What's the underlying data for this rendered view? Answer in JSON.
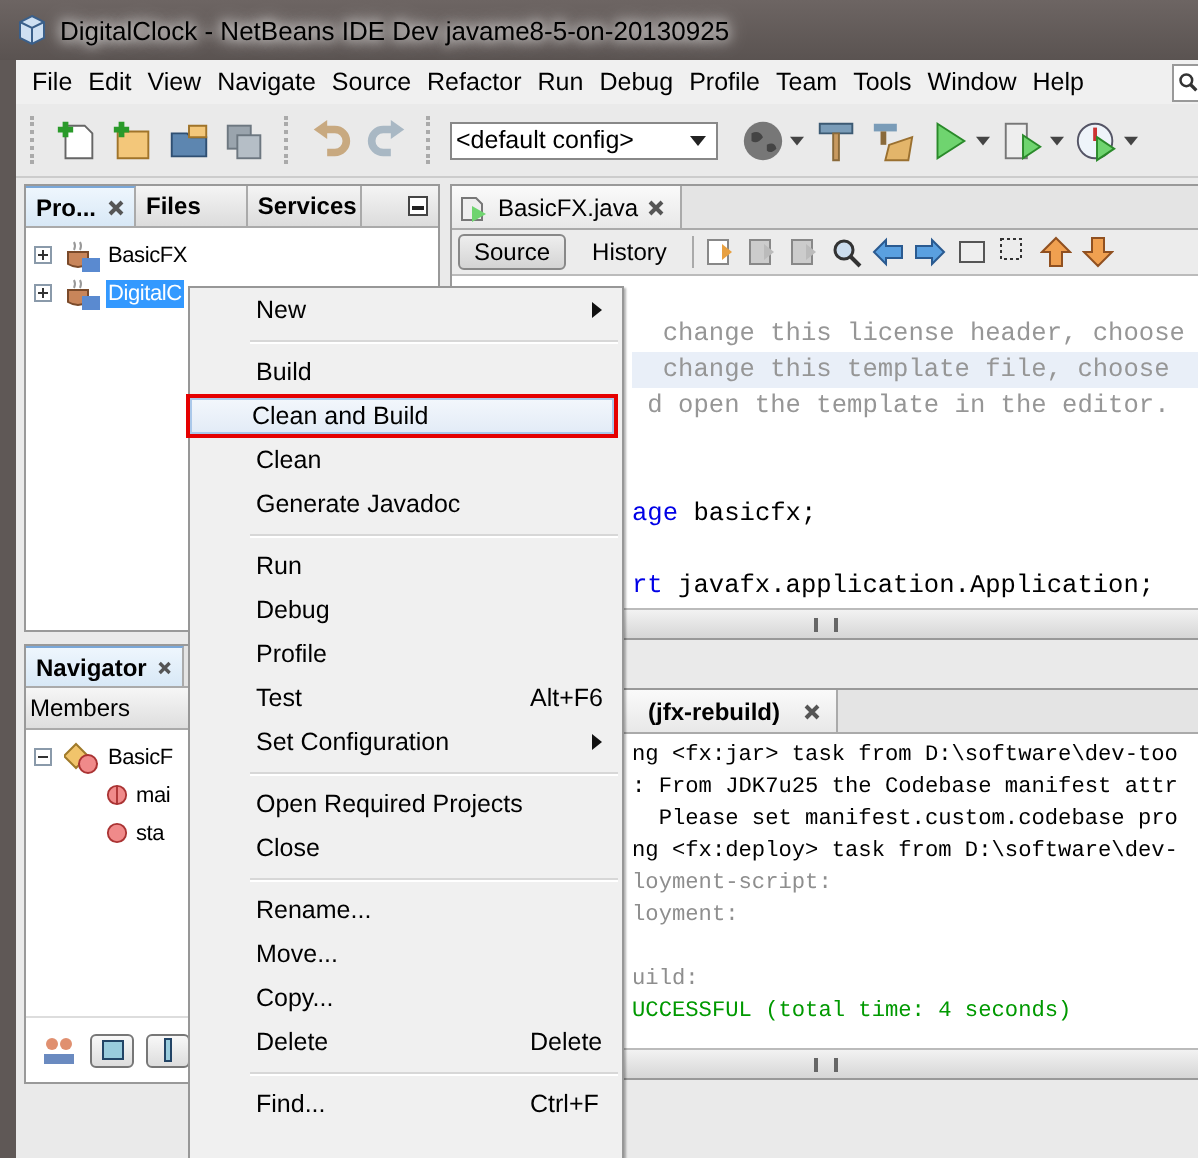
{
  "window": {
    "title": "DigitalClock - NetBeans IDE Dev javame8-5-on-20130925"
  },
  "menubar": [
    "File",
    "Edit",
    "View",
    "Navigate",
    "Source",
    "Refactor",
    "Run",
    "Debug",
    "Profile",
    "Team",
    "Tools",
    "Window",
    "Help"
  ],
  "toolbar": {
    "config": "<default config>"
  },
  "projects_panel": {
    "tabs": [
      {
        "label": "Pro...",
        "selected": true,
        "closable": true
      },
      {
        "label": "Files",
        "selected": false,
        "closable": false
      },
      {
        "label": "Services",
        "selected": false,
        "closable": false
      }
    ],
    "tree": [
      {
        "label": "BasicFX",
        "selected": false
      },
      {
        "label": "DigitalC",
        "selected": true
      }
    ]
  },
  "navigator": {
    "tab": "Navigator",
    "filter": "Members",
    "tree": {
      "label": "BasicF",
      "expanded": true,
      "children": [
        {
          "label": "mai",
          "kind": "method"
        },
        {
          "label": "sta",
          "kind": "field"
        }
      ]
    }
  },
  "editor": {
    "tab": "BasicFX.java",
    "views": [
      {
        "label": "Source",
        "selected": true
      },
      {
        "label": "History",
        "selected": false
      }
    ],
    "lines": [
      {
        "kind": "code",
        "current": false,
        "parts": [
          {
            "text": "  change this license header, choose",
            "kind": "comment"
          }
        ]
      },
      {
        "kind": "code",
        "current": true,
        "parts": [
          {
            "text": "  change this template file, choose",
            "kind": "comment"
          }
        ]
      },
      {
        "kind": "code",
        "current": false,
        "parts": [
          {
            "text": " d open the template in the editor.",
            "kind": "comment"
          }
        ]
      },
      {
        "kind": "blank"
      },
      {
        "kind": "blank"
      },
      {
        "kind": "code",
        "current": false,
        "parts": [
          {
            "text": "age",
            "kind": "keyword"
          },
          {
            "text": " basicfx;",
            "kind": "plain"
          }
        ]
      },
      {
        "kind": "blank"
      },
      {
        "kind": "code",
        "current": false,
        "parts": [
          {
            "text": "rt",
            "kind": "keyword"
          },
          {
            "text": " javafx.application.Application;",
            "kind": "plain"
          }
        ]
      }
    ]
  },
  "output": {
    "tab": "(jfx-rebuild)",
    "lines": [
      {
        "text": "ng <fx:jar> task from D:\\software\\dev-too",
        "kind": "plain"
      },
      {
        "text": ": From JDK7u25 the Codebase manifest attr",
        "kind": "plain"
      },
      {
        "text": "  Please set manifest.custom.codebase pro",
        "kind": "plain"
      },
      {
        "text": "ng <fx:deploy> task from D:\\software\\dev-",
        "kind": "plain"
      },
      {
        "text": "loyment-script:",
        "kind": "muted"
      },
      {
        "text": "loyment:",
        "kind": "muted"
      },
      {
        "kind": "blank"
      },
      {
        "text": "uild:",
        "kind": "muted"
      },
      {
        "text": "UCCESSFUL (total time: 4 seconds)",
        "kind": "success"
      }
    ]
  },
  "context_menu": [
    {
      "kind": "item",
      "label": "New",
      "submenu": true,
      "selected": false,
      "annotated": false
    },
    {
      "kind": "separator"
    },
    {
      "kind": "item",
      "label": "Build",
      "submenu": false,
      "selected": false,
      "annotated": false
    },
    {
      "kind": "item",
      "label": "Clean and Build",
      "submenu": false,
      "selected": true,
      "annotated": true
    },
    {
      "kind": "item",
      "label": "Clean",
      "submenu": false,
      "selected": false,
      "annotated": false
    },
    {
      "kind": "item",
      "label": "Generate Javadoc",
      "submenu": false,
      "selected": false,
      "annotated": false
    },
    {
      "kind": "separator"
    },
    {
      "kind": "item",
      "label": "Run",
      "submenu": false,
      "selected": false,
      "annotated": false
    },
    {
      "kind": "item",
      "label": "Debug",
      "submenu": false,
      "selected": false,
      "annotated": false
    },
    {
      "kind": "item",
      "label": "Profile",
      "submenu": false,
      "selected": false,
      "annotated": false
    },
    {
      "kind": "item",
      "label": "Test",
      "shortcut": "Alt+F6",
      "submenu": false,
      "selected": false,
      "annotated": false
    },
    {
      "kind": "item",
      "label": "Set Configuration",
      "submenu": true,
      "selected": false,
      "annotated": false
    },
    {
      "kind": "separator"
    },
    {
      "kind": "item",
      "label": "Open Required Projects",
      "submenu": false,
      "selected": false,
      "annotated": false
    },
    {
      "kind": "item",
      "label": "Close",
      "submenu": false,
      "selected": false,
      "annotated": false
    },
    {
      "kind": "separator"
    },
    {
      "kind": "item",
      "label": "Rename...",
      "submenu": false,
      "selected": false,
      "annotated": false
    },
    {
      "kind": "item",
      "label": "Move...",
      "submenu": false,
      "selected": false,
      "annotated": false
    },
    {
      "kind": "item",
      "label": "Copy...",
      "submenu": false,
      "selected": false,
      "annotated": false
    },
    {
      "kind": "item",
      "label": "Delete",
      "shortcut": "Delete",
      "submenu": false,
      "selected": false,
      "annotated": false
    },
    {
      "kind": "separator"
    },
    {
      "kind": "item",
      "label": "Find...",
      "shortcut": "Ctrl+F",
      "submenu": false,
      "selected": false,
      "annotated": false
    }
  ]
}
